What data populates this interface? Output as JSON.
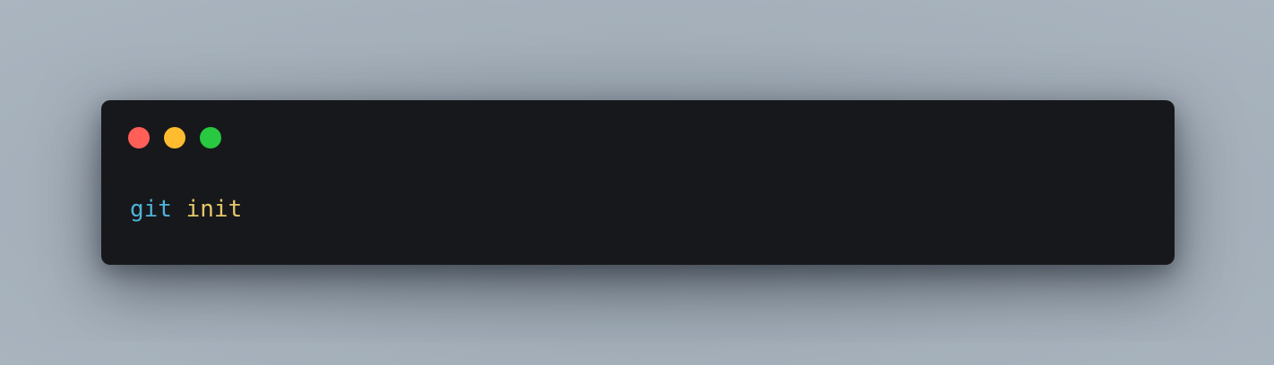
{
  "window": {
    "controls": [
      {
        "name": "close",
        "color": "#ff5f57"
      },
      {
        "name": "minimize",
        "color": "#febc2e"
      },
      {
        "name": "zoom",
        "color": "#28c840"
      }
    ]
  },
  "code": {
    "command": "git",
    "argument": "init",
    "command_color": "#4fb3d9",
    "argument_color": "#e6c76a"
  }
}
